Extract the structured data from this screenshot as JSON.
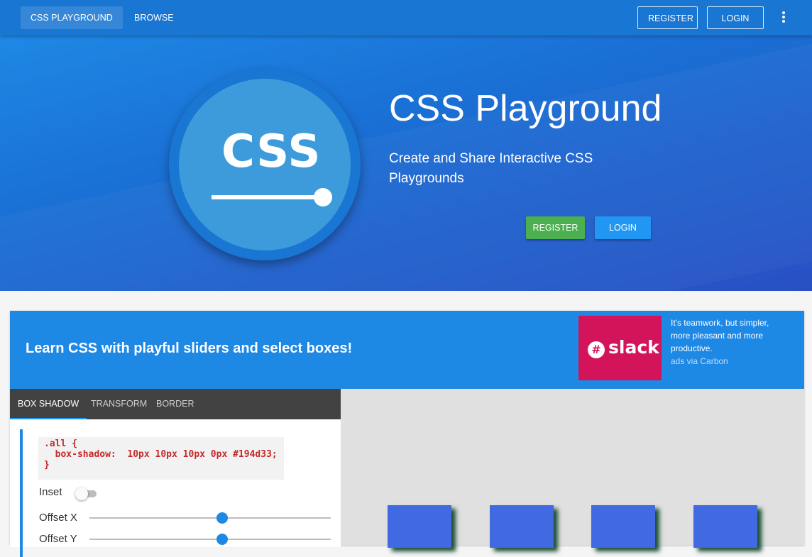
{
  "topbar": {
    "brand_label": "CSS PLAYGROUND",
    "browse_label": "BROWSE",
    "register_label": "REGISTER",
    "login_label": "LOGIN"
  },
  "hero": {
    "logo_text": "CSS",
    "title": "CSS Playground",
    "subtitle": "Create and Share Interactive CSS Playgrounds",
    "register_label": "REGISTER",
    "login_label": "LOGIN"
  },
  "learn": {
    "heading": "Learn CSS with playful sliders and select boxes!",
    "ad": {
      "brand": "slack",
      "text": "It's teamwork, but simpler, more pleasant and more productive.",
      "via": "ads via Carbon"
    },
    "tabs": [
      {
        "label": "BOX SHADOW",
        "active": true
      },
      {
        "label": "TRANSFORM",
        "active": false
      },
      {
        "label": "BORDER",
        "active": false
      }
    ],
    "code": ".all {\n  box-shadow:  10px 10px 10px 0px #194d33;\n}",
    "controls": {
      "inset_label": "Inset",
      "inset_on": false,
      "offset_x_label": "Offset X",
      "offset_x_value": 0.55,
      "offset_y_label": "Offset Y",
      "offset_y_value": 0.55
    },
    "preview_box_count": 4
  },
  "colors": {
    "topbar": "#1976d2",
    "register_green": "#4caf50",
    "login_blue": "#2196f3",
    "code_red": "#c62828",
    "preview_box": "#4169e1",
    "shadow": "#194d33",
    "ad_bg": "#d4145a"
  }
}
